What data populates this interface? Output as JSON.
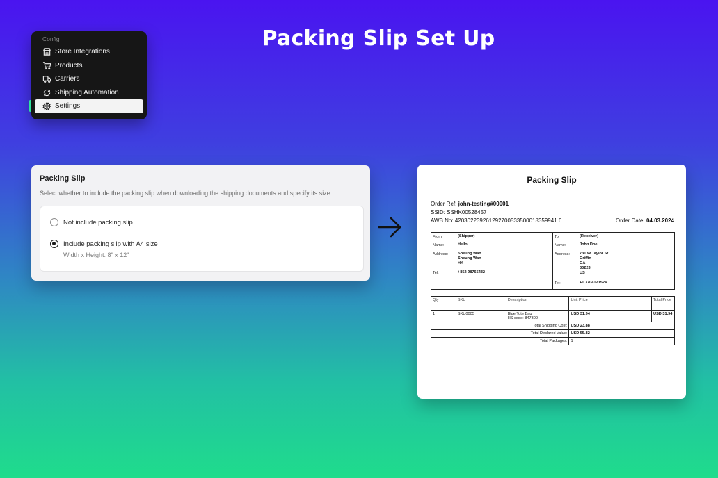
{
  "headline": "Packing Slip Set Up",
  "sidebar": {
    "section": "Config",
    "items": [
      {
        "label": "Store Integrations",
        "icon": "store-icon",
        "active": false
      },
      {
        "label": "Products",
        "icon": "cart-icon",
        "active": false
      },
      {
        "label": "Carriers",
        "icon": "truck-icon",
        "active": false
      },
      {
        "label": "Shipping Automation",
        "icon": "automation-icon",
        "active": false
      },
      {
        "label": "Settings",
        "icon": "gear-icon",
        "active": true
      }
    ],
    "accent": "#2ee1a0"
  },
  "settings_card": {
    "title": "Packing Slip",
    "description": "Select whether to include the packing slip when downloading the shipping documents and specify its size.",
    "options": [
      {
        "label": "Not include packing slip",
        "selected": false
      },
      {
        "label": "Include packing slip with A4 size",
        "selected": true,
        "sub": "Width x Height: 8\" x 12\""
      }
    ]
  },
  "arrow_icon": "arrow-right-icon",
  "slip": {
    "title": "Packing Slip",
    "order_ref_label": "Order Ref:",
    "order_ref": "john-testing#00001",
    "ssid": "SSID: SSHK00528457",
    "awb": "AWB No: 420302239261292700533500018359941 6",
    "order_date_label": "Order Date:",
    "order_date": "04.03.2024",
    "from": {
      "head_label": "From",
      "head_value": "(Shipper)",
      "name_label": "Name:",
      "name": "Hello",
      "address_label": "Address:",
      "address": [
        "Sheung Wan",
        "Sheung Wan",
        "HK"
      ],
      "tel_label": "Tel:",
      "tel": "+852 98765432"
    },
    "to": {
      "head_label": "To",
      "head_value": "(Receiver)",
      "name_label": "Name:",
      "name": "John Doe",
      "address_label": "Address:",
      "address": [
        "731 W Taylor St",
        "Griffin",
        "GA",
        "30223",
        "US"
      ],
      "tel_label": "Tel:",
      "tel": "+1 7704121524"
    },
    "items_headers": [
      "Qty",
      "SKU",
      "Description",
      "Unit Price",
      "Total Price"
    ],
    "item": {
      "qty": "1",
      "sku": "SKU0005",
      "description": "Blue Tote Bag",
      "hs_code": "HS code: 847300",
      "unit_price": "USD 31.94",
      "total_price": "USD 31.94"
    },
    "totals": [
      {
        "label": "Total Shipping Cost:",
        "value": "USD 23.88"
      },
      {
        "label": "Total Declared Value:",
        "value": "USD 55.82"
      },
      {
        "label": "Total Packages:",
        "value": "1"
      }
    ]
  }
}
